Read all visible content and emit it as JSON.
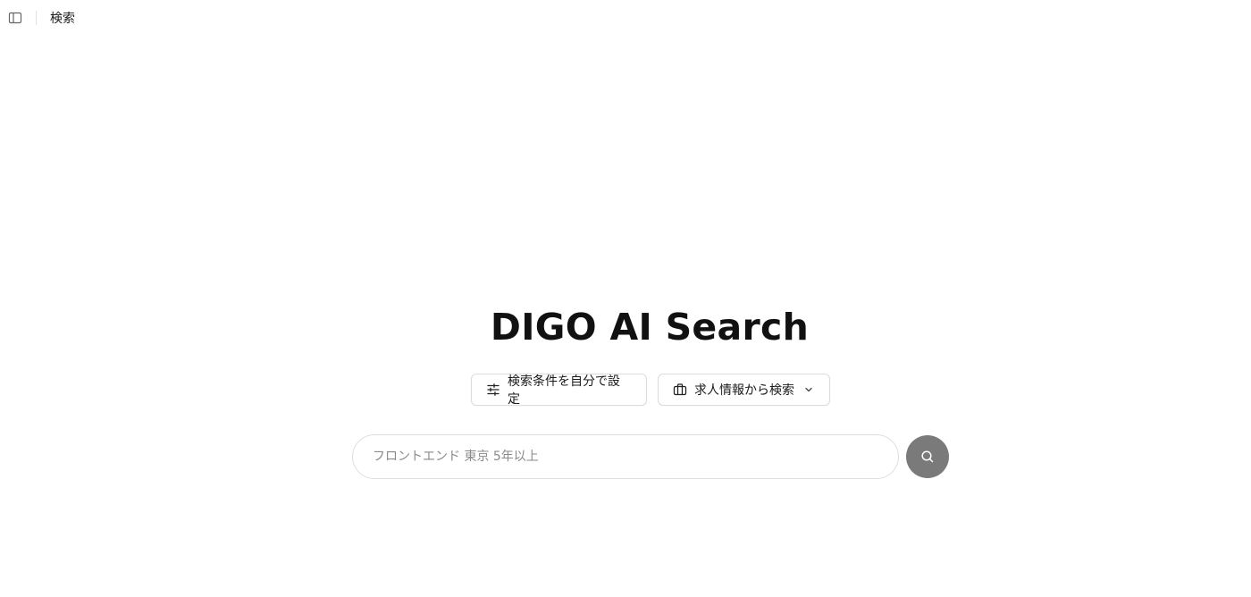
{
  "header": {
    "title": "検索",
    "sidebar_toggle_icon": "sidebar-panel-icon"
  },
  "hero": {
    "title": "DIGO AI Search"
  },
  "actions": {
    "custom_conditions_label": "検索条件を自分で設定",
    "custom_conditions_icon": "sliders-icon",
    "job_search_label": "求人情報から検索",
    "job_search_icon": "briefcase-icon",
    "job_search_chevron_icon": "chevron-down-icon"
  },
  "search": {
    "placeholder": "フロントエンド 東京 5年以上",
    "value": "",
    "button_icon": "search-icon"
  },
  "colors": {
    "search_button_bg": "#7a7a7a",
    "border": "#dcdcdc"
  }
}
